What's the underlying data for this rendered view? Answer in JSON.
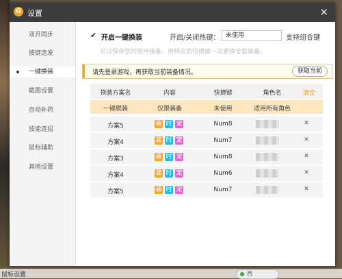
{
  "colors": {
    "titlebar": "#3b3b3b",
    "accent": "#f29b13",
    "notice_border": "#f0c77a",
    "subheader_bg": "#fde7bf",
    "tag_equip": "#f2a623",
    "tag_time": "#2eb6e6",
    "tag_window": "#e062d4"
  },
  "background": {
    "bottom_text": "鼠标设置",
    "bottom_pill": "西"
  },
  "window": {
    "title": "设置",
    "logo": "G",
    "close": "✕"
  },
  "sidebar": {
    "items": [
      {
        "label": "双开同步"
      },
      {
        "label": "按键连发"
      },
      {
        "label": "一键换装"
      },
      {
        "label": "截图设置"
      },
      {
        "label": "自动补药"
      },
      {
        "label": "技能连招"
      },
      {
        "label": "鼠标辅助"
      },
      {
        "label": "其他设置"
      }
    ],
    "active_index": 2
  },
  "options": {
    "enable_checkbox": "✔",
    "enable_label": "开启一键换装",
    "hotkey_label": "开启/关闭热键：",
    "hotkey_value": "未使用",
    "combo_label": "支持组合键",
    "hint": "可以保存您的常用装备，用特定的快捷键一次更换全套装备。"
  },
  "notice": {
    "text": "请先登录游戏，再获取当前装备情况。",
    "button": "获取当前"
  },
  "table": {
    "headers": {
      "scheme": "换装方案名",
      "content": "内容",
      "hotkey": "快捷键",
      "role": "角色名",
      "clear": "清空"
    },
    "default_row": {
      "scheme": "一键脱装",
      "content": "仅限装备",
      "hotkey": "未使用",
      "role": "适用所有角色"
    },
    "tag_labels": {
      "equip": "装",
      "time": "时",
      "window": "宠"
    },
    "delete_icon": "✕",
    "rows": [
      {
        "scheme": "方案5",
        "hotkey": "Num8"
      },
      {
        "scheme": "方案4",
        "hotkey": "Num7"
      },
      {
        "scheme": "方案3",
        "hotkey": "Num8"
      },
      {
        "scheme": "方案4",
        "hotkey": "Num6"
      },
      {
        "scheme": "方案5",
        "hotkey": "Num7"
      }
    ]
  }
}
